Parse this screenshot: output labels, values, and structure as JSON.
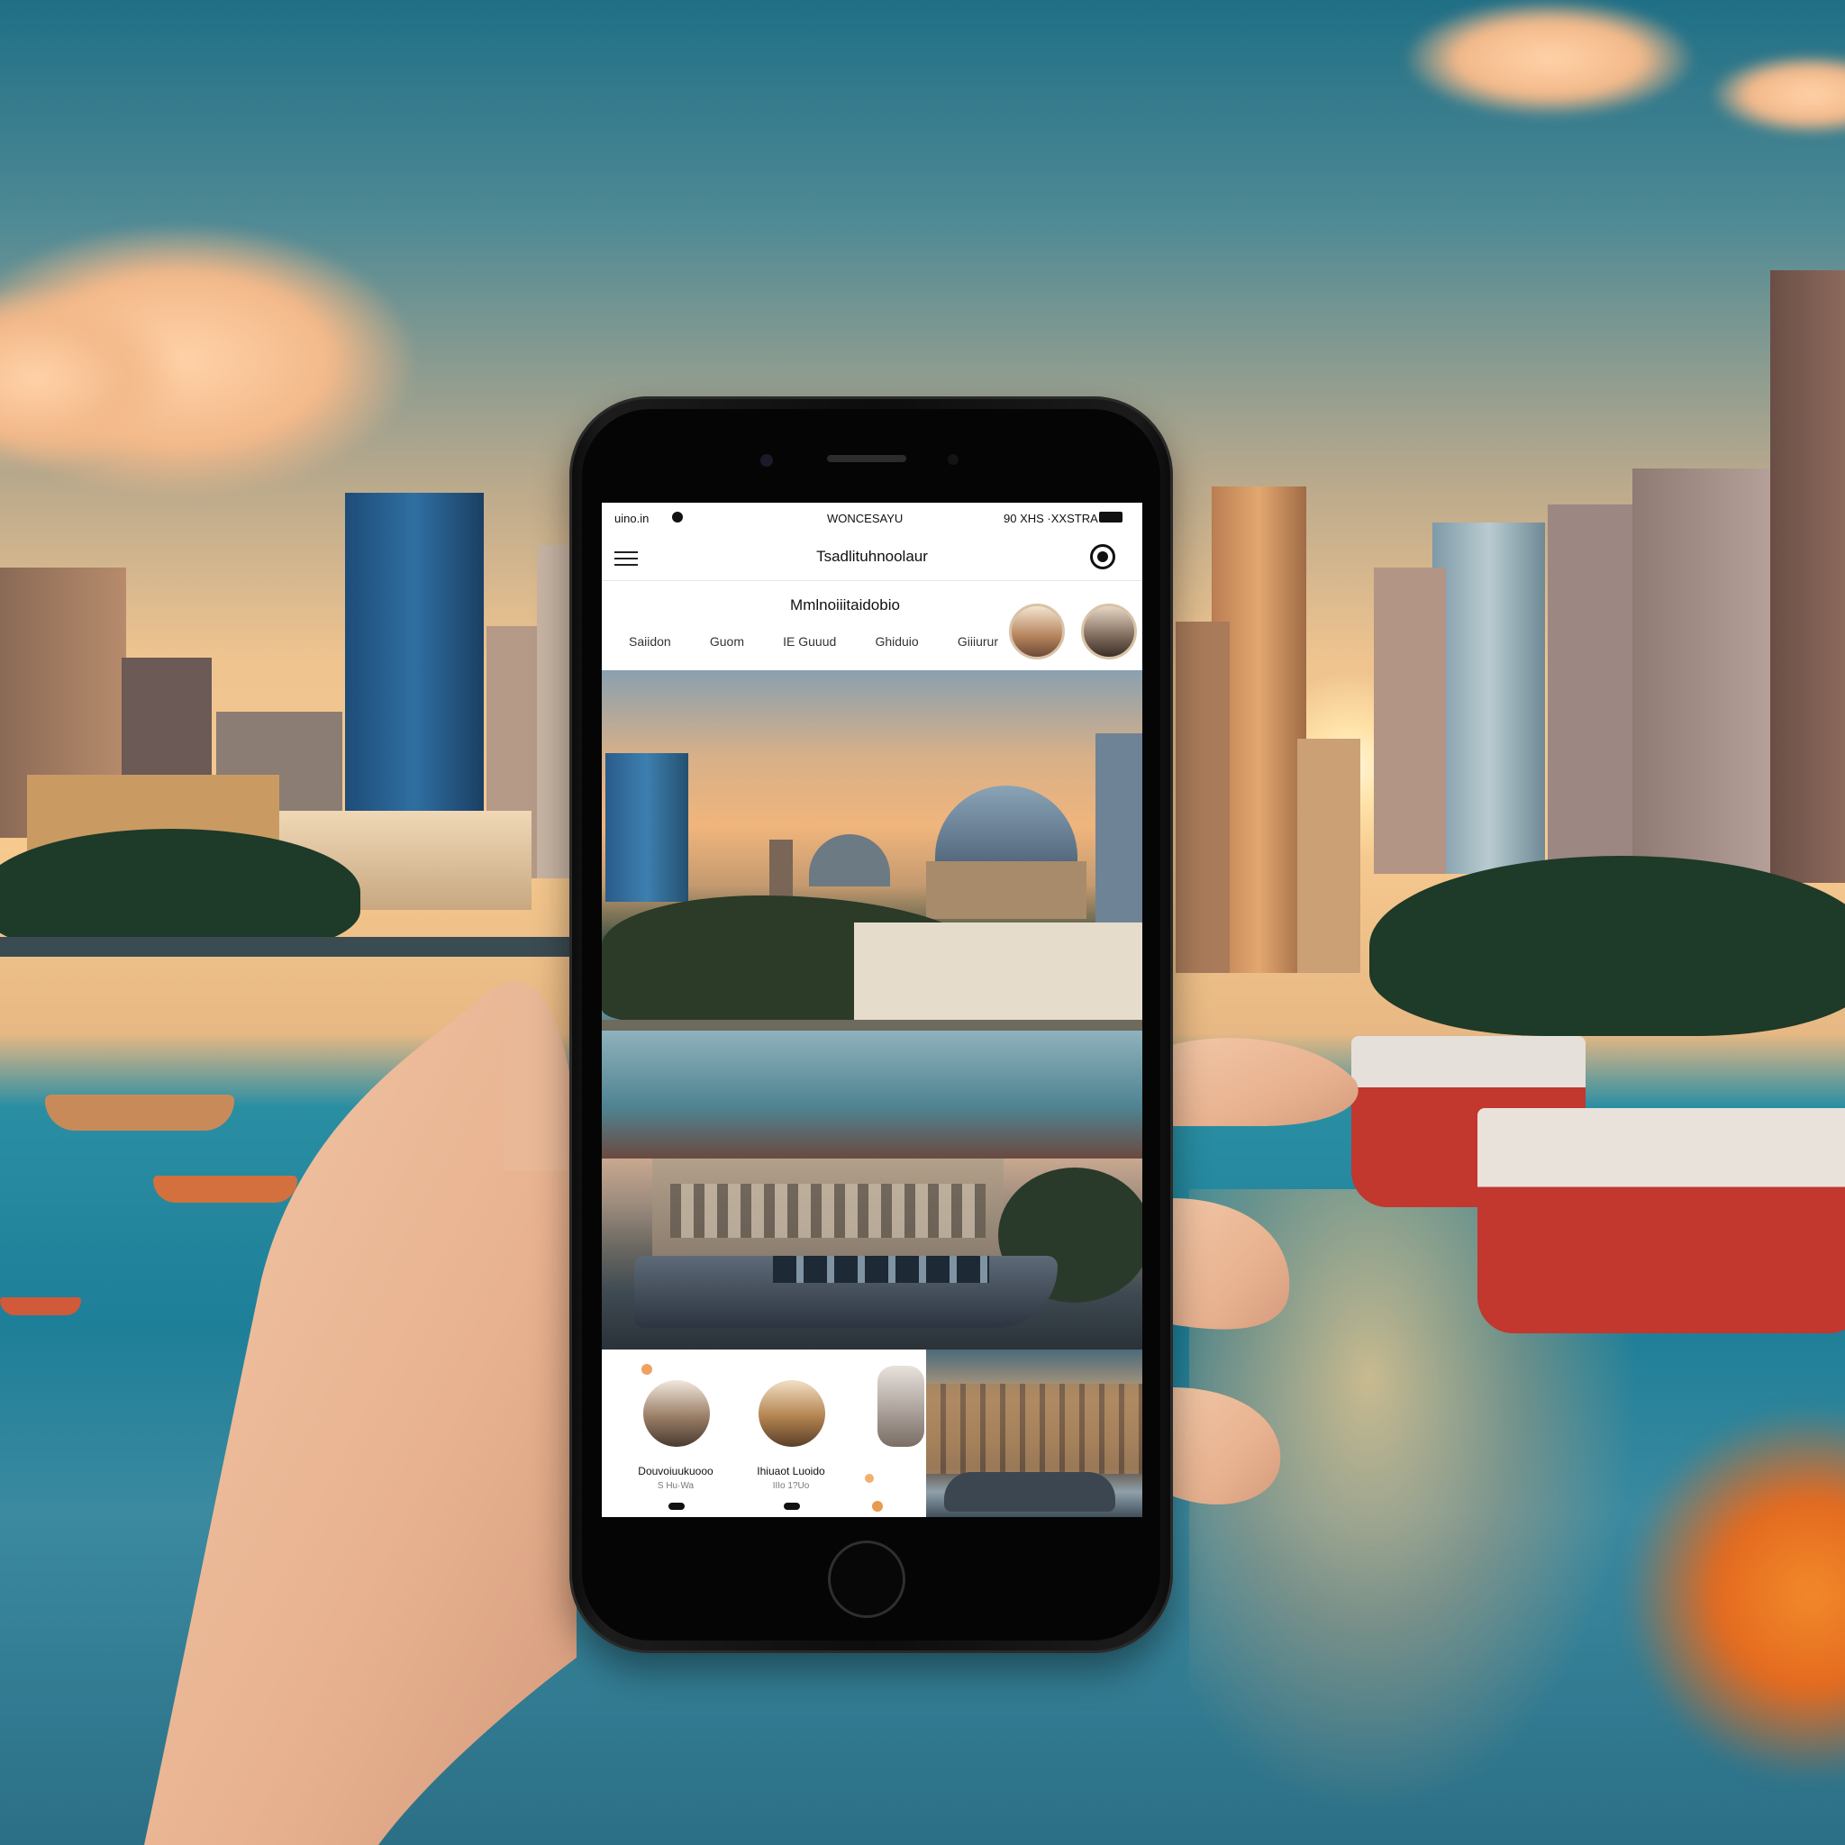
{
  "statusbar": {
    "left": "uino.in",
    "center": "WONCESAYU",
    "right": "90 XHS ·XXSTRA"
  },
  "appbar": {
    "title": "Tsadlituhnoolaur"
  },
  "section": {
    "title": "Mmlnoiiitaidobio"
  },
  "tabs": [
    "Saiidon",
    "Guom",
    "IE Guuud",
    "Ghiduio",
    "Giiiurur"
  ],
  "cards": [
    {
      "label": "Douvoiuukuooo",
      "meta": "S Hu·Wa"
    },
    {
      "label": "Ihiuaot Luoido",
      "meta": "IIIo 1?Uo"
    }
  ],
  "icons": {
    "menu": "hamburger-menu-icon",
    "profile": "profile-icon",
    "recording": "record-dot-icon",
    "battery": "battery-icon"
  },
  "colors": {
    "sky_top": "#1f6f86",
    "sunset": "#f6c98f",
    "water": "#1e7f98",
    "phone_body": "#0d0d0d",
    "boat_red": "#c2372e"
  }
}
